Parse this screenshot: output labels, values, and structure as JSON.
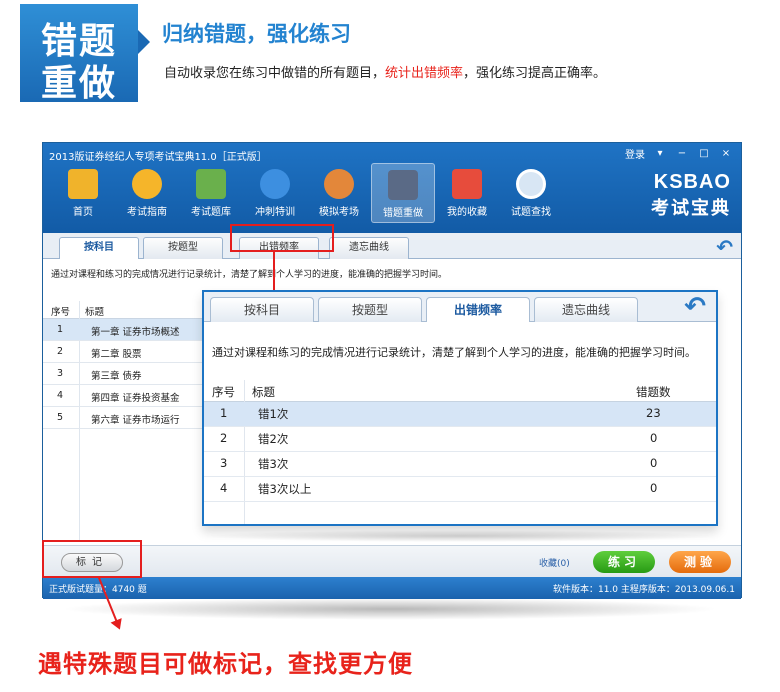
{
  "banner": {
    "badge_line1": "错题",
    "badge_line2": "重做",
    "headline": "归纳错题，强化练习",
    "sub_pre": "自动收录您在练习中做错的所有题目，",
    "sub_highlight": "统计出错频率",
    "sub_post": "，强化练习提高正确率。"
  },
  "window": {
    "title": "2013版证券经纪人专项考试宝典11.0［正式版］",
    "login": "登录",
    "logo_top": "KSBAO",
    "logo_bottom": "考试宝典",
    "toolbar": [
      {
        "label": "首页",
        "color": "#f0b32b"
      },
      {
        "label": "考试指南",
        "color": "#f5b52a"
      },
      {
        "label": "考试题库",
        "color": "#6ab04c"
      },
      {
        "label": "冲刺特训",
        "color": "#3d8fe0"
      },
      {
        "label": "模拟考场",
        "color": "#e3873a"
      },
      {
        "label": "错题重做",
        "color": "#5a6a86"
      },
      {
        "label": "我的收藏",
        "color": "#e74c3c"
      },
      {
        "label": "试题查找",
        "color": "#d8e6f4"
      }
    ],
    "tabs": [
      "按科目",
      "按题型",
      "出错频率",
      "遗忘曲线"
    ],
    "info": "通过对课程和练习的完成情况进行记录统计，清楚了解到个人学习的进度，能准确的把握学习时间。",
    "list_headers": {
      "index": "序号",
      "title": "标题"
    },
    "rows": [
      {
        "index": "1",
        "title": "第一章 证券市场概述"
      },
      {
        "index": "2",
        "title": "第二章 股票"
      },
      {
        "index": "3",
        "title": "第三章 债券"
      },
      {
        "index": "4",
        "title": "第四章 证券投资基金"
      },
      {
        "index": "5",
        "title": "第六章 证券市场运行"
      }
    ],
    "mark_button": "标记",
    "favorites": "收藏(0)",
    "practice_button": "练习",
    "test_button": "测验",
    "status_left": "正式版试题量：4740 题",
    "status_right": "软件版本：11.0 主程序版本：2013.09.06.1"
  },
  "popup": {
    "tabs": [
      "按科目",
      "按题型",
      "出错频率",
      "遗忘曲线"
    ],
    "info": "通过对课程和练习的完成情况进行记录统计，清楚了解到个人学习的进度，能准确的把握学习时间。",
    "headers": {
      "index": "序号",
      "title": "标题",
      "count": "错题数"
    },
    "rows": [
      {
        "index": "1",
        "title": "错1次",
        "count": "23"
      },
      {
        "index": "2",
        "title": "错2次",
        "count": "0"
      },
      {
        "index": "3",
        "title": "错3次",
        "count": "0"
      },
      {
        "index": "4",
        "title": "错3次以上",
        "count": "0"
      }
    ]
  },
  "caption": "遇特殊题目可做标记，查找更方便",
  "colors": {
    "accent": "#2383d0",
    "highlight": "#e8231b",
    "titlebar": "#1a69b4"
  }
}
